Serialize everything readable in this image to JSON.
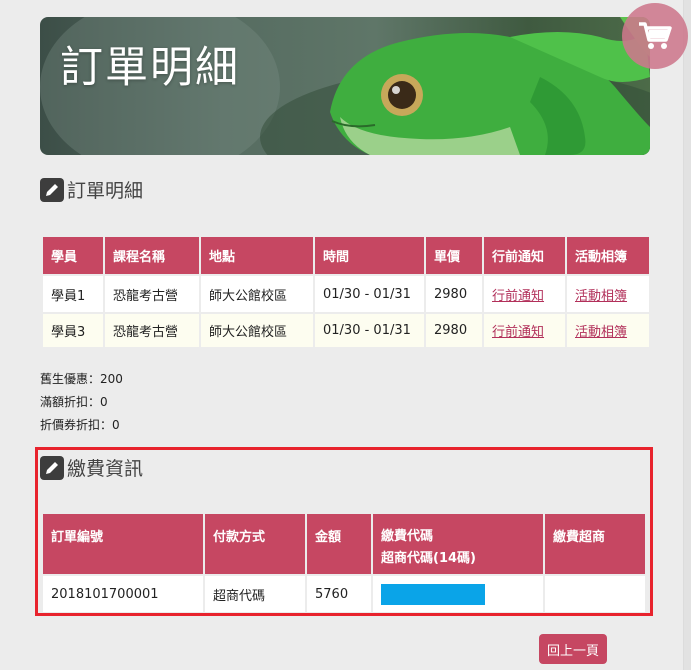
{
  "banner": {
    "title": "訂單明細"
  },
  "order_section": {
    "title": "訂單明細",
    "headers": [
      "學員",
      "課程名稱",
      "地點",
      "時間",
      "單價",
      "行前通知",
      "活動相簿"
    ],
    "rows": [
      {
        "student": "學員1",
        "course": "恐龍考古營",
        "location": "師大公館校區",
        "time": "01/30 - 01/31",
        "price": "2980",
        "notice": "行前通知",
        "album": "活動相簿"
      },
      {
        "student": "學員3",
        "course": "恐龍考古營",
        "location": "師大公館校區",
        "time": "01/30 - 01/31",
        "price": "2980",
        "notice": "行前通知",
        "album": "活動相簿"
      }
    ]
  },
  "discounts": {
    "returning_label": "舊生優惠：",
    "returning_value": "200",
    "threshold_label": "滿額折扣：",
    "threshold_value": "0",
    "coupon_label": "折價券折扣：",
    "coupon_value": "0"
  },
  "payment_section": {
    "title": "繳費資訊",
    "headers": {
      "order_no": "訂單編號",
      "method": "付款方式",
      "amount": "金額",
      "code": "繳費代碼",
      "code_sub": "超商代碼(14碼)",
      "store": "繳費超商"
    },
    "row": {
      "order_no": "2018101700001",
      "method": "超商代碼",
      "amount": "5760",
      "store": ""
    }
  },
  "colors": {
    "accent": "#c64762",
    "highlight_border": "#e8232d",
    "code_bar": "#0aa4e8"
  },
  "icons": {
    "cart": "shopping-cart-icon",
    "edit": "pencil-icon"
  },
  "back_button": {
    "label": "回上一頁"
  }
}
